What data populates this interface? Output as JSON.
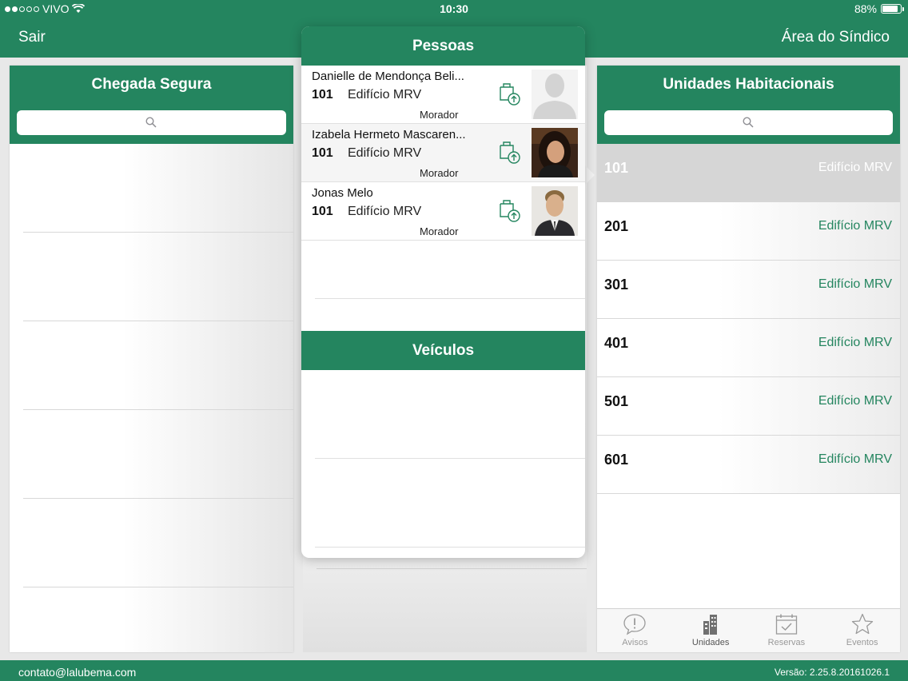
{
  "status_bar": {
    "carrier": "VIVO",
    "time": "10:30",
    "battery": "88%"
  },
  "nav": {
    "left_label": "Sair",
    "right_label": "Área do Síndico"
  },
  "left_panel": {
    "title": "Chegada Segura"
  },
  "popover": {
    "people_title": "Pessoas",
    "vehicles_title": "Veículos",
    "people": [
      {
        "name": "Danielle de Mendonça Beli...",
        "unit": "101",
        "building": "Edifício MRV",
        "role": "Morador",
        "photo": "placeholder-avatar"
      },
      {
        "name": "Izabela Hermeto Mascaren...",
        "unit": "101",
        "building": "Edifício MRV",
        "role": "Morador",
        "photo": "woman-photo"
      },
      {
        "name": "Jonas Melo",
        "unit": "101",
        "building": "Edifício MRV",
        "role": "Morador",
        "photo": "man-photo"
      }
    ]
  },
  "right_panel": {
    "title": "Unidades Habitacionais",
    "units": [
      {
        "number": "101",
        "building": "Edifício MRV",
        "selected": true
      },
      {
        "number": "201",
        "building": "Edifício MRV",
        "selected": false
      },
      {
        "number": "301",
        "building": "Edifício MRV",
        "selected": false
      },
      {
        "number": "401",
        "building": "Edifício MRV",
        "selected": false
      },
      {
        "number": "501",
        "building": "Edifício MRV",
        "selected": false
      },
      {
        "number": "601",
        "building": "Edifício MRV",
        "selected": false
      }
    ],
    "tabs": [
      {
        "label": "Avisos",
        "icon": "alert-bubble-icon",
        "active": false
      },
      {
        "label": "Unidades",
        "icon": "buildings-icon",
        "active": true
      },
      {
        "label": "Reservas",
        "icon": "calendar-check-icon",
        "active": false
      },
      {
        "label": "Eventos",
        "icon": "star-icon",
        "active": false
      }
    ]
  },
  "footer": {
    "email": "contato@lalubema.com",
    "version": "Versão: 2.25.8.20161026.1"
  },
  "colors": {
    "brand_green": "#24855f",
    "selected_row": "#d6d6d6"
  }
}
